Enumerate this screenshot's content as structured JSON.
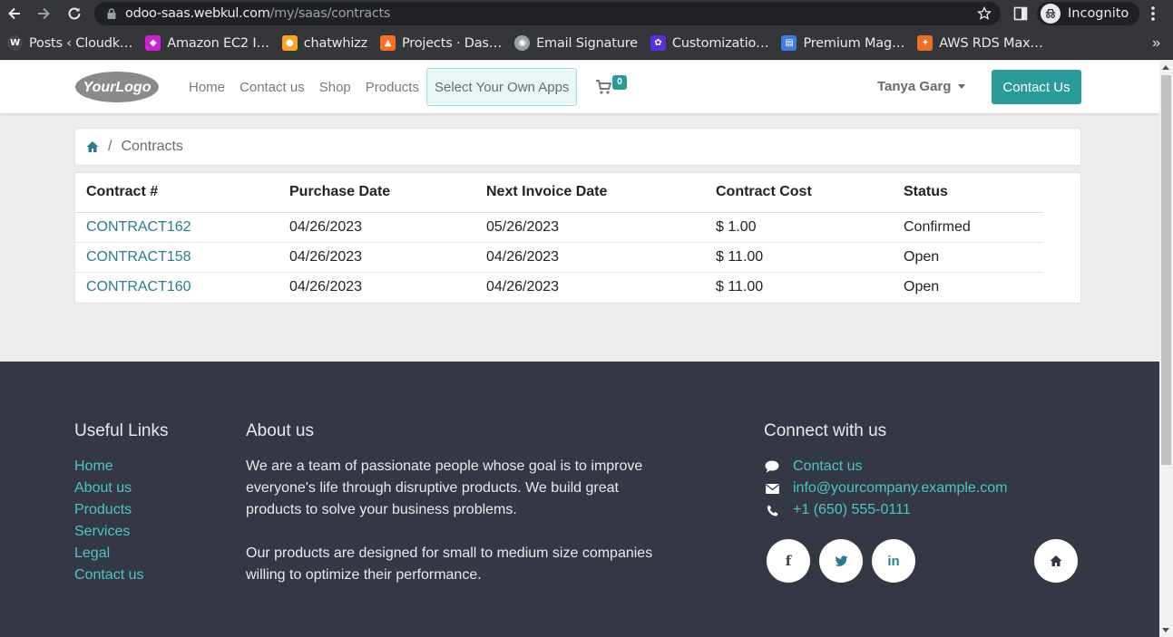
{
  "browser": {
    "url_host": "odoo-saas.webkul.com",
    "url_path": "/my/saas/contracts",
    "profile_label": "Incognito",
    "bookmarks": [
      {
        "label": "Posts ‹ Cloudk…",
        "icon": "wordpress-icon",
        "color": "#464646"
      },
      {
        "label": "Amazon EC2 I…",
        "icon": "amazon-ec2-icon",
        "color": "#c925d1"
      },
      {
        "label": "chatwhizz",
        "icon": "chatwhizz-icon",
        "color": "#f5a623"
      },
      {
        "label": "Projects · Das…",
        "icon": "gitlab-icon",
        "color": "#fc6d26"
      },
      {
        "label": "Email Signature",
        "icon": "globe-icon",
        "color": "#9aa0a6"
      },
      {
        "label": "Customizatio…",
        "icon": "customization-icon",
        "color": "#5b2ee0"
      },
      {
        "label": "Premium Mag…",
        "icon": "premium-icon",
        "color": "#3f7de0"
      },
      {
        "label": "AWS RDS Max…",
        "icon": "aws-rds-icon",
        "color": "#e8722c"
      }
    ]
  },
  "header": {
    "logo_text": "YourLogo",
    "menu": [
      "Home",
      "Contact us",
      "Shop",
      "Products"
    ],
    "select_apps_label": "Select Your Own Apps",
    "cart_count": "0",
    "user_name": "Tanya Garg",
    "contact_button": "Contact Us"
  },
  "breadcrumb": {
    "current": "Contracts"
  },
  "contracts_table": {
    "columns": [
      "Contract #",
      "Purchase Date",
      "Next Invoice Date",
      "Contract Cost",
      "Status"
    ],
    "rows": [
      [
        "CONTRACT162",
        "04/26/2023",
        "05/26/2023",
        "$ 1.00",
        "Confirmed"
      ],
      [
        "CONTRACT158",
        "04/26/2023",
        "04/26/2023",
        "$ 11.00",
        "Open"
      ],
      [
        "CONTRACT160",
        "04/26/2023",
        "04/26/2023",
        "$ 11.00",
        "Open"
      ]
    ]
  },
  "footer": {
    "useful_links_title": "Useful Links",
    "useful_links": [
      "Home",
      "About us",
      "Products",
      "Services",
      "Legal",
      "Contact us"
    ],
    "about_title": "About us",
    "about_p1": "We are a team of passionate people whose goal is to improve everyone's life through disruptive products. We build great products to solve your business problems.",
    "about_p2": "Our products are designed for small to medium size companies willing to optimize their performance.",
    "connect_title": "Connect with us",
    "connect_items": [
      {
        "label": "Contact us",
        "icon": "comment-icon"
      },
      {
        "label": "info@yourcompany.example.com",
        "icon": "envelope-icon"
      },
      {
        "label": "+1 (650) 555-0111",
        "icon": "phone-icon"
      }
    ],
    "social": [
      {
        "name": "facebook-icon",
        "glyph": "f"
      },
      {
        "name": "twitter-icon",
        "glyph": ""
      },
      {
        "name": "linkedin-icon",
        "glyph": "in"
      },
      {
        "name": "home-icon",
        "glyph": ""
      }
    ]
  },
  "colors": {
    "accent": "#2a9a9b",
    "link": "#2a7c8c",
    "footer_bg": "#343844",
    "footer_link": "#4fc4c4"
  }
}
